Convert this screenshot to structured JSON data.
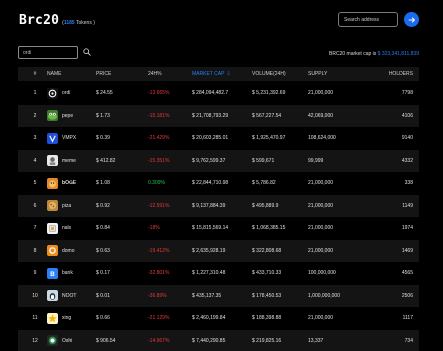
{
  "header": {
    "logo_text": "Brc20",
    "logo_open": "(",
    "logo_hl": "1185",
    "logo_tail": " Tokens )",
    "search_placeholder": "Search address"
  },
  "filter": {
    "value": "ordi"
  },
  "market_cap": {
    "label": "BRC20 market cap is ",
    "value": "$ 323,341,811,839"
  },
  "table": {
    "columns": {
      "rank": "#",
      "name": "NAME",
      "price": "PRICE",
      "change": "24H%",
      "market_cap": "MARKET CAP",
      "volume": "VOLUME(24H)",
      "supply": "SUPPLY",
      "holders": "HOLDERS"
    },
    "sort_arrow": "⇩",
    "rows": [
      {
        "rank": "1",
        "name": "ordi",
        "icon": "ordi-icon",
        "price": "$ 24.55",
        "change": "-13.665%",
        "trend": "neg",
        "market_cap": "$ 284,094,482.7",
        "volume": "$ 5,231,392.69",
        "supply": "21,000,000",
        "holders": "7798"
      },
      {
        "rank": "2",
        "name": "pepe",
        "icon": "pepe-icon",
        "price": "$ 1.73",
        "change": "-15.181%",
        "trend": "neg",
        "market_cap": "$ 21,708,793.29",
        "volume": "$ 567,227.54",
        "supply": "42,069,000",
        "holders": "4106"
      },
      {
        "rank": "3",
        "name": "VMPX",
        "icon": "vmpx-icon",
        "price": "$ 0.39",
        "change": "-21.429%",
        "trend": "neg",
        "market_cap": "$ 20,603,285.01",
        "volume": "$ 1,925,470.97",
        "supply": "108,624,000",
        "holders": "9140"
      },
      {
        "rank": "4",
        "name": "meme",
        "icon": "meme-icon",
        "price": "$ 412.82",
        "change": "-15.351%",
        "trend": "neg",
        "market_cap": "$ 9,762,599.37",
        "volume": "$ 599,671",
        "supply": "99,999",
        "holders": "4332"
      },
      {
        "rank": "5",
        "name": "𝐛𝐎𝐆𝐄",
        "icon": "boge-icon",
        "price": "$ 1.08",
        "change": "0.309%",
        "trend": "pos",
        "market_cap": "$ 22,844,710.98",
        "volume": "$ 5,786.82",
        "supply": "21,000,000",
        "holders": "338"
      },
      {
        "rank": "6",
        "name": "piza",
        "icon": "piza-icon",
        "price": "$ 0.92",
        "change": "-12.591%",
        "trend": "neg",
        "market_cap": "$ 9,137,884.39",
        "volume": "$ 495,889.9",
        "supply": "21,000,000",
        "holders": "1149"
      },
      {
        "rank": "7",
        "name": "nals",
        "icon": "nals-icon",
        "price": "$ 0.84",
        "change": "-18%",
        "trend": "neg",
        "market_cap": "$ 15,815,569.14",
        "volume": "$ 1,068,385.15",
        "supply": "21,000,000",
        "holders": "1974"
      },
      {
        "rank": "8",
        "name": "domo",
        "icon": "domo-icon",
        "price": "$ 0.63",
        "change": "-19.412%",
        "trend": "neg",
        "market_cap": "$ 2,635,928.19",
        "volume": "$ 322,808.68",
        "supply": "21,000,000",
        "holders": "1469"
      },
      {
        "rank": "9",
        "name": "bank",
        "icon": "bank-icon",
        "price": "$ 0.17",
        "change": "-32.801%",
        "trend": "neg",
        "market_cap": "$ 1,227,310.48",
        "volume": "$ 433,710.33",
        "supply": "100,000,000",
        "holders": "4565"
      },
      {
        "rank": "10",
        "name": "NOOT",
        "icon": "noot-icon",
        "price": "$ 0.01",
        "change": "-36.89%",
        "trend": "neg",
        "market_cap": "$ 435,137.35",
        "volume": "$ 178,450.53",
        "supply": "1,000,000,000",
        "holders": "2506"
      },
      {
        "rank": "11",
        "name": "xing",
        "icon": "xing-icon",
        "price": "$ 0.66",
        "change": "-21.129%",
        "trend": "neg",
        "market_cap": "$ 2,460,199.84",
        "volume": "$ 188,398.88",
        "supply": "21,000,000",
        "holders": "1117"
      },
      {
        "rank": "12",
        "name": "Oshi",
        "icon": "oshi-icon",
        "price": "$ 906.54",
        "change": "-14.967%",
        "trend": "neg",
        "market_cap": "$ 7,440,290.85",
        "volume": "$ 219,825.16",
        "supply": "13,337",
        "holders": "734"
      }
    ]
  },
  "colors": {
    "accent": "#2a7ef7",
    "negative": "#e23b3b",
    "positive": "#21c34a",
    "row_alt": "#141414"
  }
}
